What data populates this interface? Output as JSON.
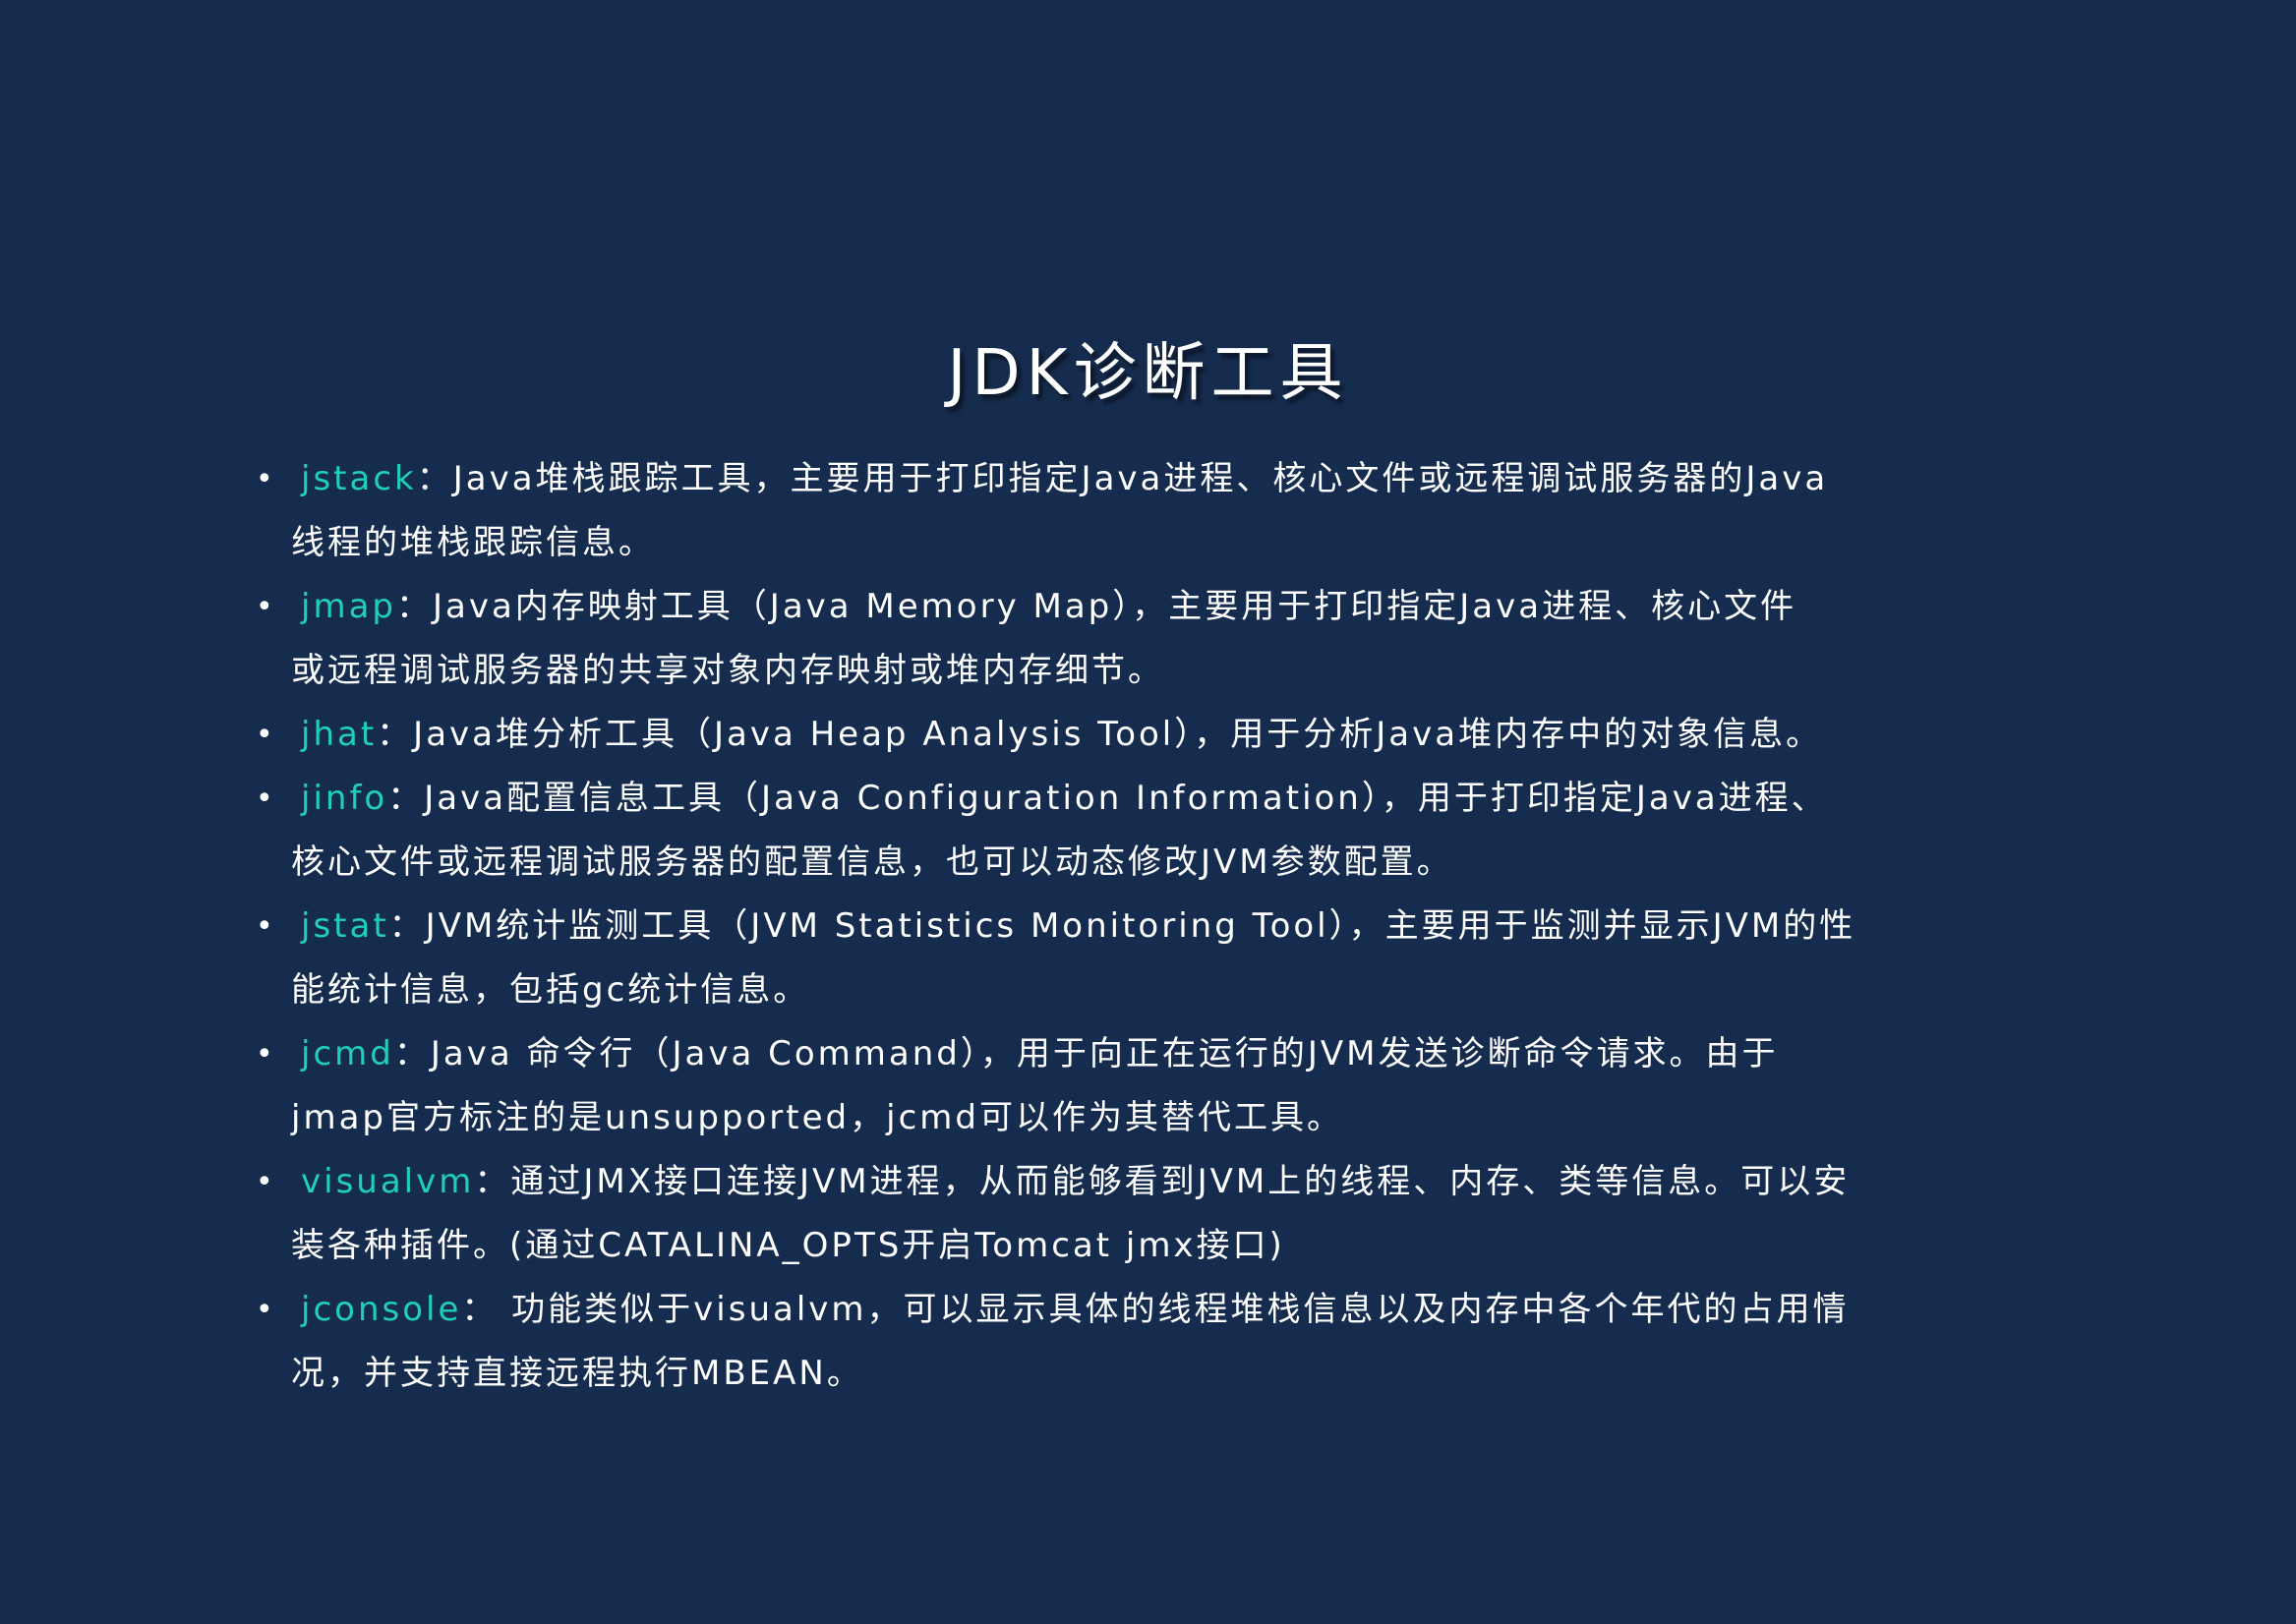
{
  "title": "JDK诊断工具",
  "accent_color": "#1fcfb8",
  "background_color": "#162c4f",
  "items": [
    {
      "term": "jstack",
      "lines": [
        "：Java堆栈跟踪工具，主要用于打印指定Java进程、核心文件或远程调试服务器的Java",
        "线程的堆栈跟踪信息。"
      ]
    },
    {
      "term": "jmap",
      "lines": [
        "：Java内存映射工具（Java Memory Map），主要用于打印指定Java进程、核心文件",
        "或远程调试服务器的共享对象内存映射或堆内存细节。"
      ]
    },
    {
      "term": "jhat",
      "lines": [
        "：Java堆分析工具（Java Heap Analysis Tool），用于分析Java堆内存中的对象信息。"
      ]
    },
    {
      "term": "jinfo",
      "lines": [
        "：Java配置信息工具（Java Configuration Information），用于打印指定Java进程、",
        "核心文件或远程调试服务器的配置信息，也可以动态修改JVM参数配置。"
      ]
    },
    {
      "term": "jstat",
      "lines": [
        "：JVM统计监测工具（JVM Statistics Monitoring Tool），主要用于监测并显示JVM的性",
        "能统计信息，包括gc统计信息。"
      ]
    },
    {
      "term": "jcmd",
      "lines": [
        "：Java 命令行（Java Command），用于向正在运行的JVM发送诊断命令请求。由于",
        "jmap官方标注的是unsupported，jcmd可以作为其替代工具。"
      ]
    },
    {
      "term": "visualvm",
      "lines": [
        "：通过JMX接口连接JVM进程，从而能够看到JVM上的线程、内存、类等信息。可以安",
        "装各种插件。(通过CATALINA_OPTS开启Tomcat jmx接口)"
      ]
    },
    {
      "term": "jconsole",
      "lines": [
        "： 功能类似于visualvm，可以显示具体的线程堆栈信息以及内存中各个年代的占用情",
        "况，并支持直接远程执行MBEAN。"
      ]
    }
  ]
}
